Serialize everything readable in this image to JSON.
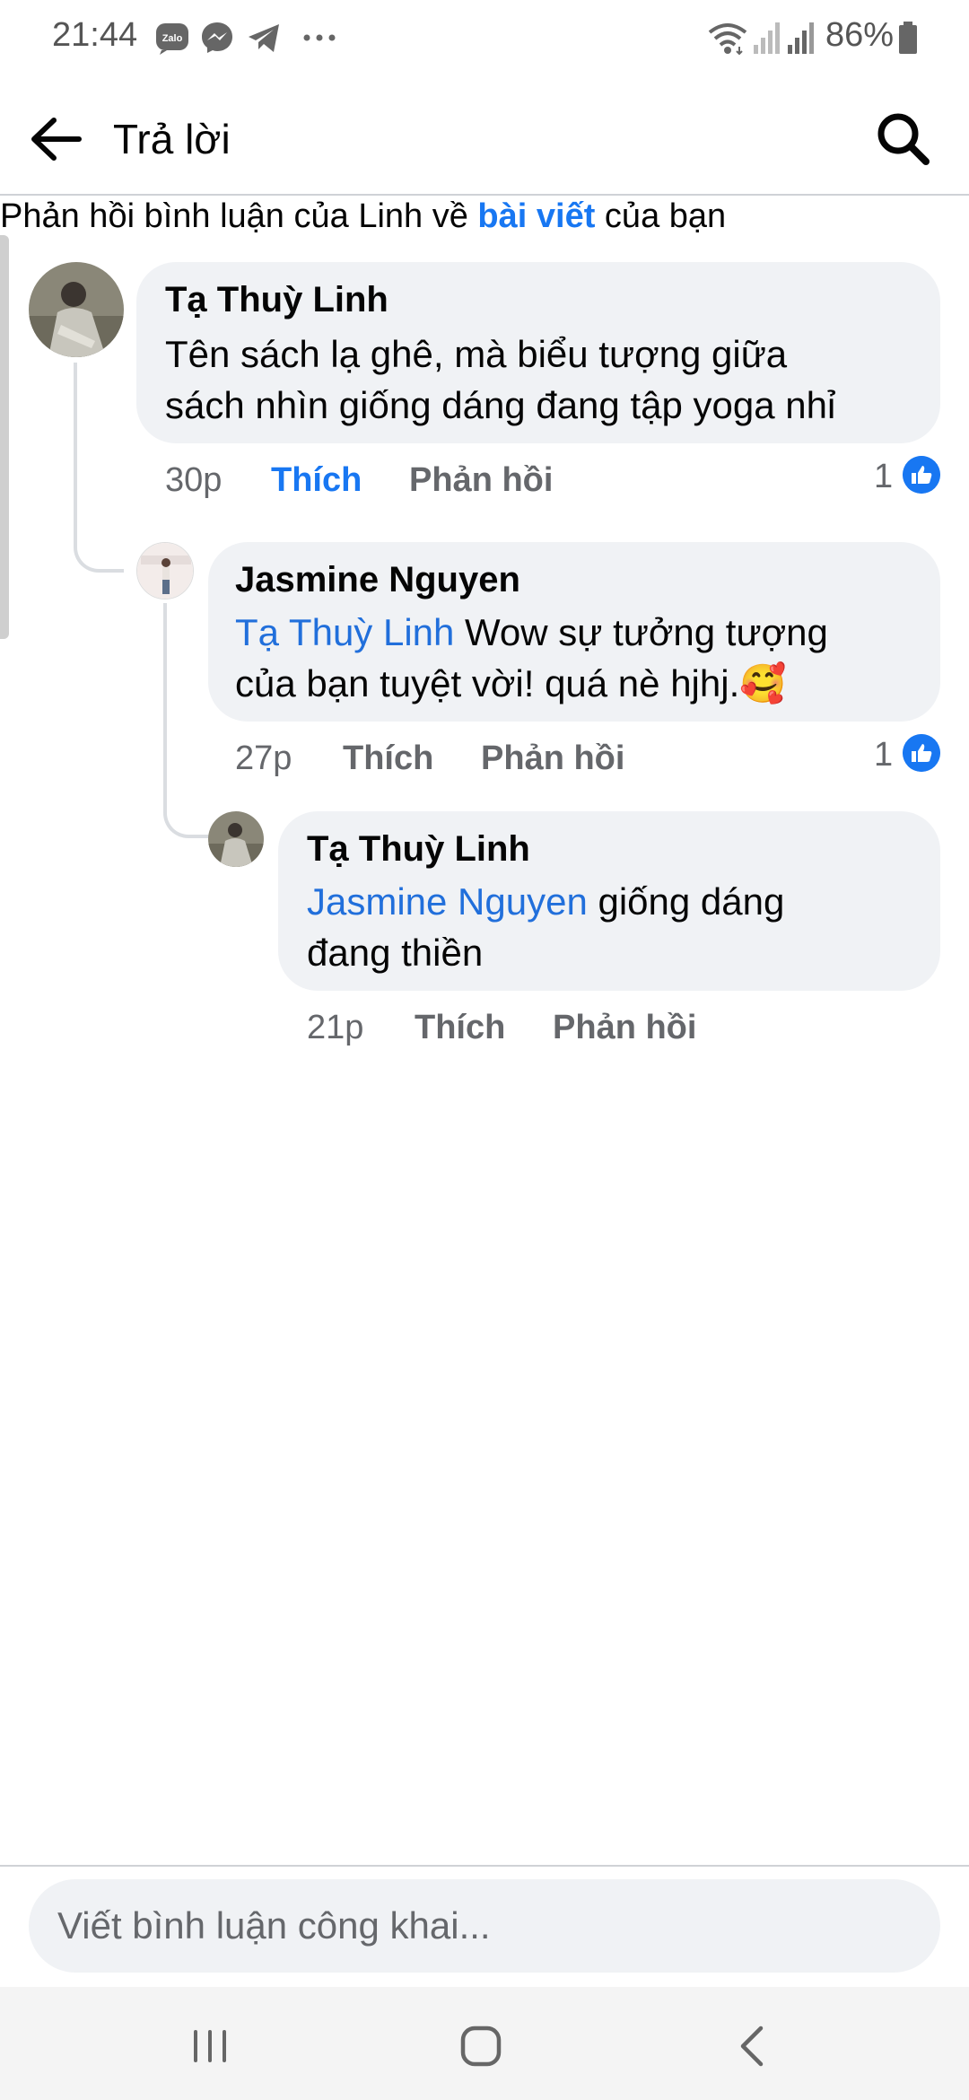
{
  "status_bar": {
    "time": "21:44",
    "notification_icons": [
      "zalo-icon",
      "messenger-icon",
      "telegram-icon",
      "more-dots-icon"
    ],
    "system_icons": [
      "wifi-icon",
      "signal-icon",
      "signal-icon",
      "battery-icon"
    ],
    "battery_percent": "86%"
  },
  "header": {
    "title": "Trả lời"
  },
  "context": {
    "prefix": "Phản hồi bình luận của Linh về ",
    "link": "bài viết",
    "suffix": " của bạn"
  },
  "comments": [
    {
      "author": "Tạ Thuỳ Linh",
      "line1": "Tên sách lạ ghê, mà biểu tượng giữa",
      "line2": "sách nhìn giống dáng đang tập yoga nhỉ",
      "time": "30p",
      "like_label": "Thích",
      "reply_label": "Phản hồi",
      "reaction_count": "1",
      "liked": true
    },
    {
      "author": "Jasmine Nguyen",
      "mention": "Tạ Thuỳ Linh",
      "line1_rest": " Wow sự tưởng tượng",
      "line2": "của bạn tuyệt vời! quá nè hjhj.",
      "emoji": "🥰",
      "time": "27p",
      "like_label": "Thích",
      "reply_label": "Phản hồi",
      "reaction_count": "1",
      "liked": false
    },
    {
      "author": "Tạ Thuỳ Linh",
      "mention": "Jasmine Nguyen",
      "line1_rest": " giống dáng",
      "line2": "đang thiền",
      "time": "21p",
      "like_label": "Thích",
      "reply_label": "Phản hồi",
      "liked": false
    }
  ],
  "composer": {
    "placeholder": "Viết bình luận công khai..."
  },
  "nav_bar": {
    "buttons": [
      "recent-apps-icon",
      "home-icon",
      "back-nav-icon"
    ]
  },
  "colors": {
    "accent": "#1877f2",
    "mention": "#216fdb",
    "bubble": "#f0f2f5",
    "secondary_text": "#65676b"
  }
}
